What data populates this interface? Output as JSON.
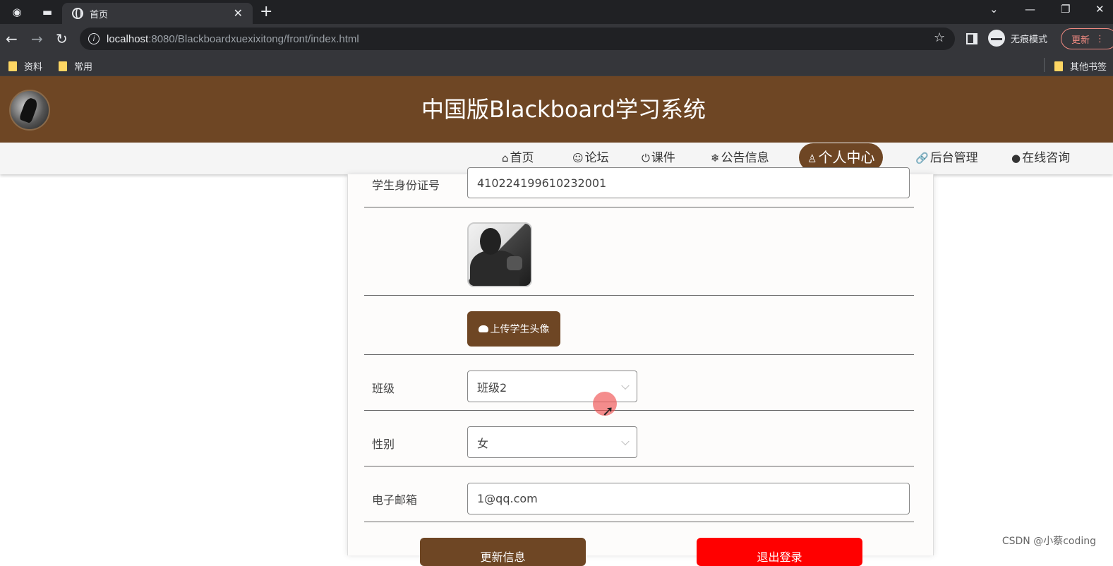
{
  "browser": {
    "tab_title": "首页",
    "url_host": "localhost",
    "url_path": ":8080/Blackboardxuexixitong/front/index.html",
    "incognito_label": "无痕模式",
    "update_label": "更新",
    "bookmarks": [
      "资料",
      "常用"
    ],
    "other_bookmarks": "其他书签"
  },
  "site": {
    "title": "中国版Blackboard学习系统"
  },
  "nav": {
    "items": [
      {
        "icon": "⌂",
        "label": "首页"
      },
      {
        "icon": "☺",
        "label": "论坛"
      },
      {
        "icon": "⏻",
        "label": "课件"
      },
      {
        "icon": "❄",
        "label": "公告信息"
      },
      {
        "icon": "♙",
        "label": "个人中心"
      },
      {
        "icon": "🔗",
        "label": "后台管理"
      },
      {
        "icon": "●",
        "label": "在线咨询"
      }
    ],
    "active_index": 4
  },
  "form": {
    "id_label": "学生身份证号",
    "id_value": "410224199610232001",
    "upload_label": "上传学生头像",
    "class_label": "班级",
    "class_value": "班级2",
    "gender_label": "性别",
    "gender_value": "女",
    "email_label": "电子邮箱",
    "email_value": "1@qq.com",
    "update_button": "更新信息",
    "logout_button": "退出登录"
  },
  "watermark": "CSDN @小蔡coding",
  "colors": {
    "brand_brown": "#6e4624",
    "logout_red": "#ff0000"
  }
}
